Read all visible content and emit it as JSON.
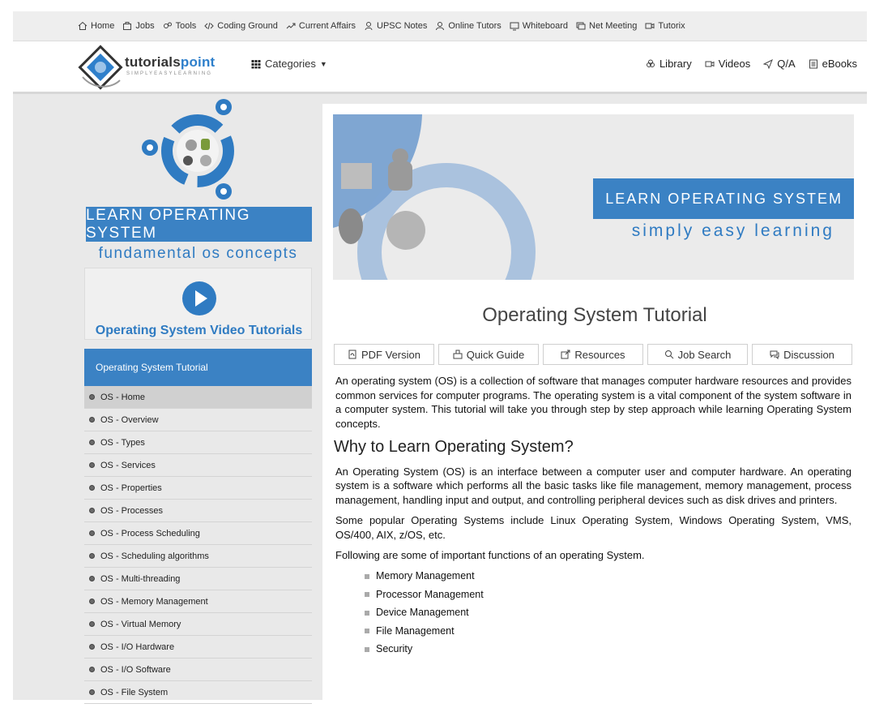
{
  "topnav": [
    {
      "label": "Home",
      "icon": "home-icon"
    },
    {
      "label": "Jobs",
      "icon": "briefcase-icon"
    },
    {
      "label": "Tools",
      "icon": "tools-icon"
    },
    {
      "label": "Coding Ground",
      "icon": "code-icon"
    },
    {
      "label": "Current Affairs",
      "icon": "current-affairs-icon"
    },
    {
      "label": "UPSC Notes",
      "icon": "notes-icon"
    },
    {
      "label": "Online Tutors",
      "icon": "tutor-icon"
    },
    {
      "label": "Whiteboard",
      "icon": "whiteboard-icon"
    },
    {
      "label": "Net Meeting",
      "icon": "meeting-icon"
    },
    {
      "label": "Tutorix",
      "icon": "tutorix-icon"
    }
  ],
  "header": {
    "logo_main": "tutorials",
    "logo_accent": "point",
    "logo_tagline": "SIMPLYEASYLEARNING",
    "categories_label": "Categories",
    "right_nav": [
      {
        "label": "Library",
        "icon": "library-icon"
      },
      {
        "label": "Videos",
        "icon": "video-icon"
      },
      {
        "label": "Q/A",
        "icon": "send-icon"
      },
      {
        "label": "eBooks",
        "icon": "ebook-icon"
      }
    ]
  },
  "sidebar": {
    "banner_title": "LEARN OPERATING SYSTEM",
    "banner_subtitle": "fundamental os concepts",
    "video_title": "Operating System Video Tutorials",
    "menu_heading": "Operating System Tutorial",
    "items": [
      {
        "label": "OS - Home",
        "active": true
      },
      {
        "label": "OS - Overview"
      },
      {
        "label": "OS - Types"
      },
      {
        "label": "OS - Services"
      },
      {
        "label": "OS - Properties"
      },
      {
        "label": "OS - Processes"
      },
      {
        "label": "OS - Process Scheduling"
      },
      {
        "label": "OS - Scheduling algorithms"
      },
      {
        "label": "OS - Multi-threading"
      },
      {
        "label": "OS - Memory Management"
      },
      {
        "label": "OS - Virtual Memory"
      },
      {
        "label": "OS - I/O Hardware"
      },
      {
        "label": "OS - I/O Software"
      },
      {
        "label": "OS - File System"
      }
    ]
  },
  "main": {
    "hero_title": "LEARN OPERATING SYSTEM",
    "hero_subtitle": "simply easy learning",
    "page_title": "Operating System Tutorial",
    "buttons": [
      {
        "label": "PDF Version",
        "icon": "pdf-icon"
      },
      {
        "label": "Quick Guide",
        "icon": "quick-guide-icon"
      },
      {
        "label": "Resources",
        "icon": "external-link-icon"
      },
      {
        "label": "Job Search",
        "icon": "search-icon"
      },
      {
        "label": "Discussion",
        "icon": "chat-icon"
      }
    ],
    "intro": "An operating system (OS) is a collection of software that manages computer hardware resources and provides common services for computer programs. The operating system is a vital component of the system software in a computer system. This tutorial will take you through step by step approach while learning Operating System concepts.",
    "section_heading": "Why to Learn Operating System?",
    "para1": "An Operating System (OS) is an interface between a computer user and computer hardware. An operating system is a software which performs all the basic tasks like file management, memory management, process management, handling input and output, and controlling peripheral devices such as disk drives and printers.",
    "para2": "Some popular Operating Systems include Linux Operating System, Windows Operating System, VMS, OS/400, AIX, z/OS, etc.",
    "para3": "Following are some of important functions of an operating System.",
    "functions": [
      "Memory Management",
      "Processor Management",
      "Device Management",
      "File Management",
      "Security"
    ]
  },
  "colors": {
    "brand_blue": "#3b82c4",
    "menu_active": "#d0d0d0",
    "page_bg": "#e9e9e9"
  }
}
